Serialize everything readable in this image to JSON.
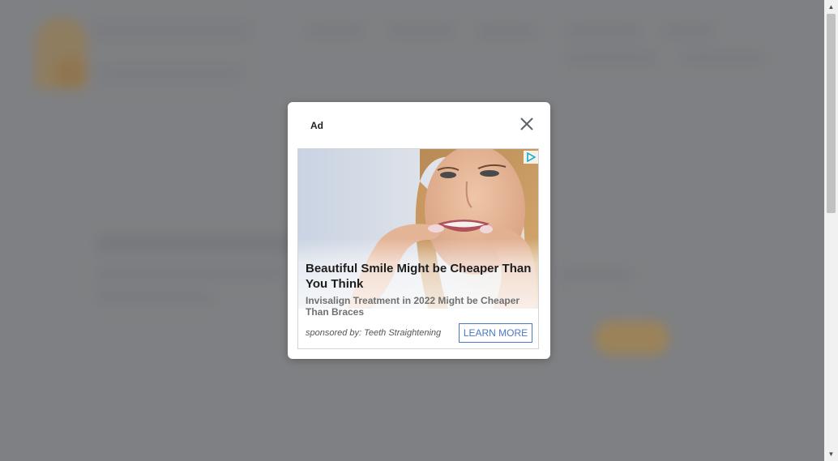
{
  "colors": {
    "overlay": "#7f8083",
    "modal_bg": "#ffffff",
    "cta_border": "#4a78c5",
    "headline": "#1d1d1d",
    "description": "#707070",
    "blurred_accent": "#9b8259"
  },
  "modal": {
    "ad_label": "Ad",
    "close_icon": "close-icon",
    "adchoices_icon": "adchoices-icon",
    "ad": {
      "headline": "Beautiful Smile Might be Cheaper Than You Think",
      "description": "Invisalign Treatment in 2022 Might be Cheaper Than Braces",
      "sponsor": "sponsored by: Teeth Straightening",
      "cta_label": "LEARN MORE",
      "image": "woman-inserting-clear-aligner-photo"
    }
  },
  "scrollbar": {
    "up_icon": "arrow-up-icon",
    "down_icon": "arrow-down-icon"
  }
}
